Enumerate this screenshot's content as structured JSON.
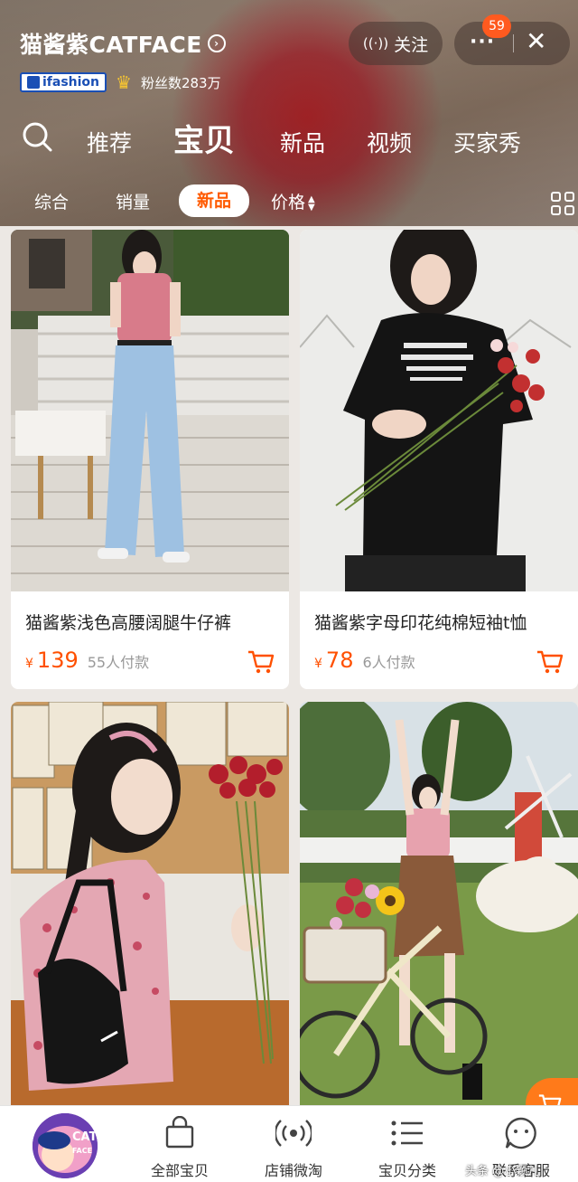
{
  "shop": {
    "name": "猫酱紫CATFACE",
    "arrow": "›",
    "ifashion_label": "ifashion",
    "crown_icon": "crown-icon",
    "fans": "粉丝数283万",
    "follow_label": "关注",
    "more_label": "···",
    "notif_count": "59",
    "close_label": "✕"
  },
  "nav": {
    "tabs": [
      {
        "label": "推荐"
      },
      {
        "label": "宝贝"
      },
      {
        "label": "新品"
      },
      {
        "label": "视频"
      },
      {
        "label": "买家秀"
      }
    ],
    "active_index": 1
  },
  "sort": {
    "items": [
      {
        "label": "综合"
      },
      {
        "label": "销量"
      },
      {
        "label": "新品"
      },
      {
        "label": "价格"
      }
    ],
    "active_index": 2
  },
  "products": [
    {
      "title": "猫酱紫浅色高腰阔腿牛仔裤",
      "currency": "¥",
      "price": "139",
      "sold": "55人付款"
    },
    {
      "title": "猫酱紫字母印花纯棉短袖t恤",
      "currency": "¥",
      "price": "78",
      "sold": "6人付款"
    },
    {
      "title": "",
      "currency": "",
      "price": "",
      "sold": ""
    },
    {
      "title": "",
      "currency": "",
      "price": "",
      "sold": ""
    }
  ],
  "bottom_bar": {
    "logo_text": "CAT FACE",
    "items": [
      {
        "label": "全部宝贝",
        "icon": "bag-icon"
      },
      {
        "label": "店铺微淘",
        "icon": "broadcast-icon"
      },
      {
        "label": "宝贝分类",
        "icon": "list-icon"
      },
      {
        "label": "联系客服",
        "icon": "chat-face-icon"
      }
    ]
  },
  "watermark": "头条 @小颖儿",
  "colors": {
    "accent": "#ff5000",
    "header_bg": "#957f6f",
    "ifashion_blue": "#1a4fb5"
  }
}
